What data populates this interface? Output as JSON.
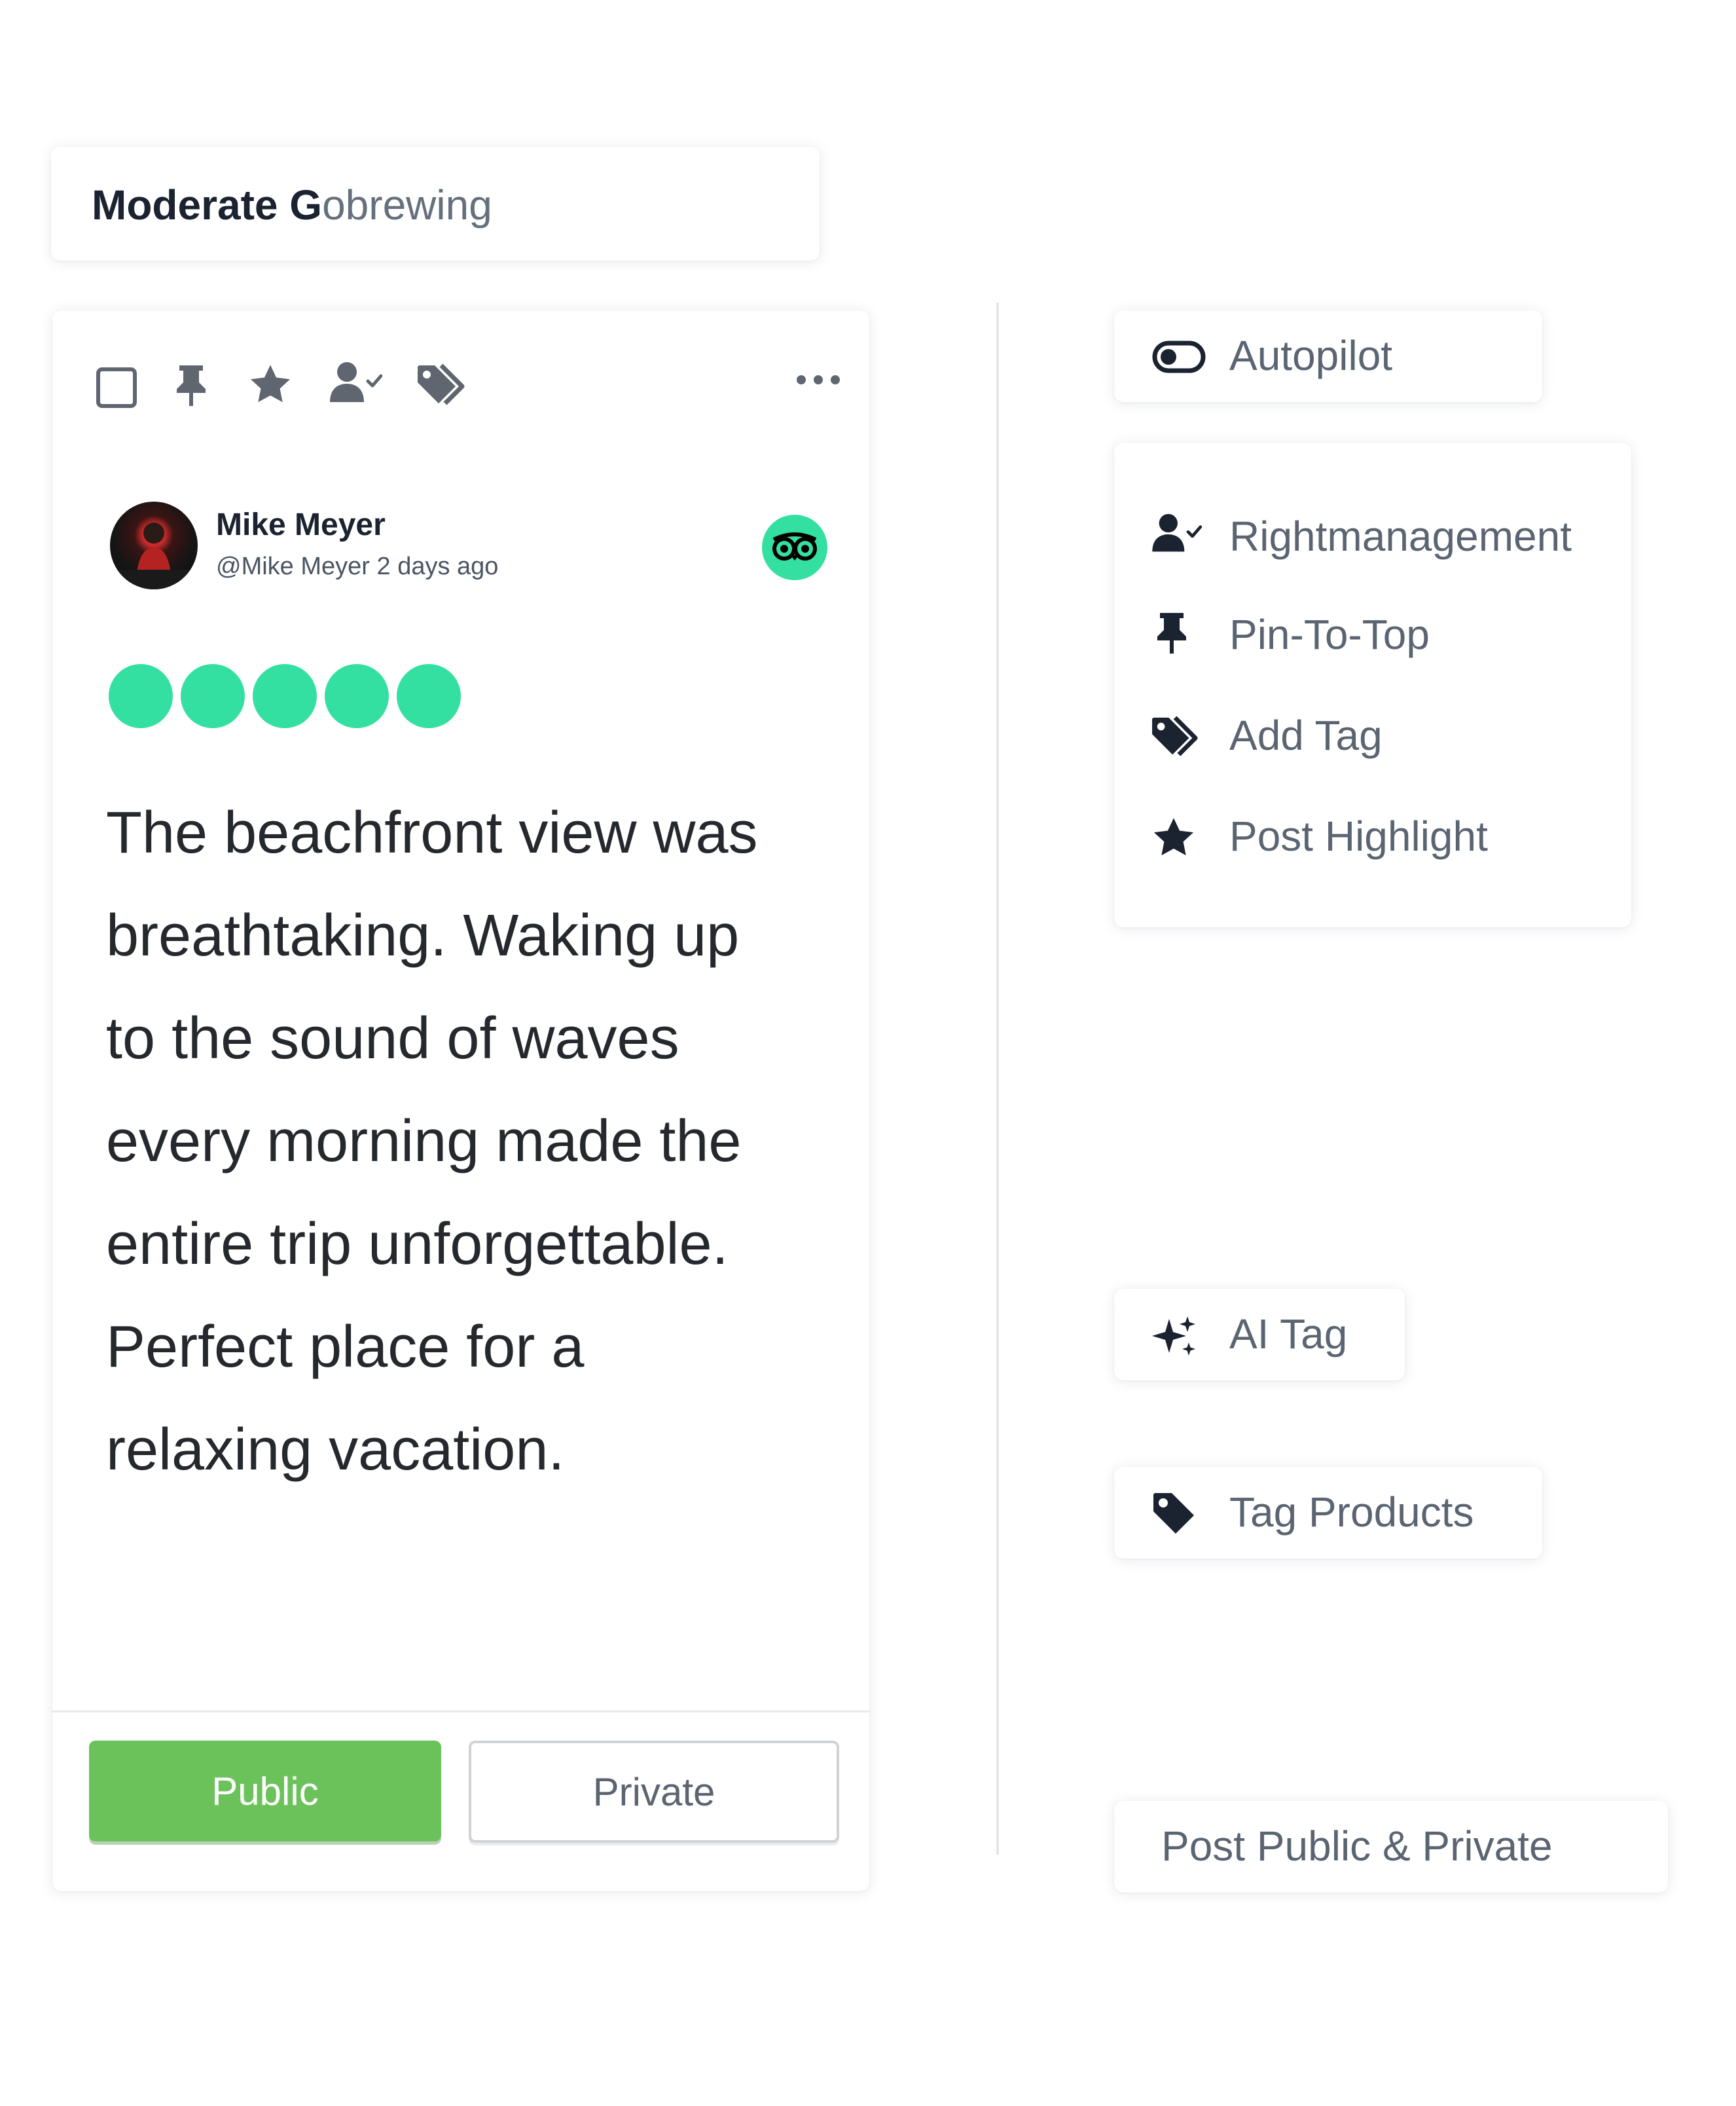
{
  "title": {
    "strong": "Moderate G",
    "light": "obrewing"
  },
  "card": {
    "toolbar": {
      "icons": [
        "checkbox-icon",
        "pin-icon",
        "star-icon",
        "user-check-icon",
        "tags-icon",
        "more-icon"
      ]
    },
    "author": {
      "name": "Mike Meyer",
      "handle": "@Mike Meyer 2 days ago"
    },
    "source_icon": "tripadvisor-icon",
    "rating": {
      "value": 5,
      "max": 5,
      "color": "#34e0a1"
    },
    "review_lines": [
      "The beachfront view was",
      "breathtaking. Waking up",
      "to the sound of waves",
      "every morning made the",
      "entire trip unforgettable.",
      "Perfect place for a",
      "relaxing vacation."
    ],
    "buttons": {
      "public": "Public",
      "private": "Private"
    }
  },
  "features": {
    "autopilot": "Autopilot",
    "menu": [
      {
        "label": "Rightmanagement",
        "icon": "user-check-icon"
      },
      {
        "label": "Pin-To-Top",
        "icon": "pin-icon"
      },
      {
        "label": "Add Tag",
        "icon": "tags-icon"
      },
      {
        "label": "Post Highlight",
        "icon": "star-icon"
      }
    ],
    "ai_tag": "AI Tag",
    "tag_products": "Tag Products",
    "post_public_private": "Post Public & Private"
  },
  "colors": {
    "accent_green": "#34e0a1",
    "public_button": "#6cc25a",
    "text_dark": "#1b2230",
    "text_muted": "#5b6572",
    "icon_gray": "#5f6670"
  }
}
